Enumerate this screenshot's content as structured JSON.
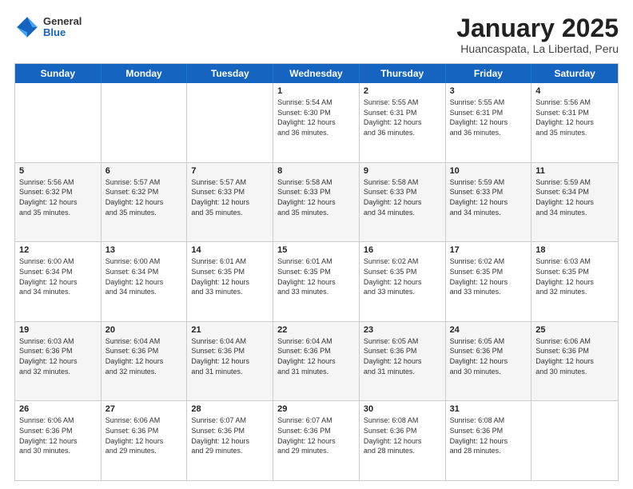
{
  "header": {
    "logo": {
      "general": "General",
      "blue": "Blue"
    },
    "title": "January 2025",
    "subtitle": "Huancaspata, La Libertad, Peru"
  },
  "days": [
    "Sunday",
    "Monday",
    "Tuesday",
    "Wednesday",
    "Thursday",
    "Friday",
    "Saturday"
  ],
  "weeks": [
    [
      {
        "date": "",
        "info": "",
        "empty": true
      },
      {
        "date": "",
        "info": "",
        "empty": true
      },
      {
        "date": "",
        "info": "",
        "empty": true
      },
      {
        "date": "1",
        "info": "Sunrise: 5:54 AM\nSunset: 6:30 PM\nDaylight: 12 hours\nand 36 minutes.",
        "empty": false
      },
      {
        "date": "2",
        "info": "Sunrise: 5:55 AM\nSunset: 6:31 PM\nDaylight: 12 hours\nand 36 minutes.",
        "empty": false
      },
      {
        "date": "3",
        "info": "Sunrise: 5:55 AM\nSunset: 6:31 PM\nDaylight: 12 hours\nand 36 minutes.",
        "empty": false
      },
      {
        "date": "4",
        "info": "Sunrise: 5:56 AM\nSunset: 6:31 PM\nDaylight: 12 hours\nand 35 minutes.",
        "empty": false
      }
    ],
    [
      {
        "date": "5",
        "info": "Sunrise: 5:56 AM\nSunset: 6:32 PM\nDaylight: 12 hours\nand 35 minutes.",
        "empty": false
      },
      {
        "date": "6",
        "info": "Sunrise: 5:57 AM\nSunset: 6:32 PM\nDaylight: 12 hours\nand 35 minutes.",
        "empty": false
      },
      {
        "date": "7",
        "info": "Sunrise: 5:57 AM\nSunset: 6:33 PM\nDaylight: 12 hours\nand 35 minutes.",
        "empty": false
      },
      {
        "date": "8",
        "info": "Sunrise: 5:58 AM\nSunset: 6:33 PM\nDaylight: 12 hours\nand 35 minutes.",
        "empty": false
      },
      {
        "date": "9",
        "info": "Sunrise: 5:58 AM\nSunset: 6:33 PM\nDaylight: 12 hours\nand 34 minutes.",
        "empty": false
      },
      {
        "date": "10",
        "info": "Sunrise: 5:59 AM\nSunset: 6:33 PM\nDaylight: 12 hours\nand 34 minutes.",
        "empty": false
      },
      {
        "date": "11",
        "info": "Sunrise: 5:59 AM\nSunset: 6:34 PM\nDaylight: 12 hours\nand 34 minutes.",
        "empty": false
      }
    ],
    [
      {
        "date": "12",
        "info": "Sunrise: 6:00 AM\nSunset: 6:34 PM\nDaylight: 12 hours\nand 34 minutes.",
        "empty": false
      },
      {
        "date": "13",
        "info": "Sunrise: 6:00 AM\nSunset: 6:34 PM\nDaylight: 12 hours\nand 34 minutes.",
        "empty": false
      },
      {
        "date": "14",
        "info": "Sunrise: 6:01 AM\nSunset: 6:35 PM\nDaylight: 12 hours\nand 33 minutes.",
        "empty": false
      },
      {
        "date": "15",
        "info": "Sunrise: 6:01 AM\nSunset: 6:35 PM\nDaylight: 12 hours\nand 33 minutes.",
        "empty": false
      },
      {
        "date": "16",
        "info": "Sunrise: 6:02 AM\nSunset: 6:35 PM\nDaylight: 12 hours\nand 33 minutes.",
        "empty": false
      },
      {
        "date": "17",
        "info": "Sunrise: 6:02 AM\nSunset: 6:35 PM\nDaylight: 12 hours\nand 33 minutes.",
        "empty": false
      },
      {
        "date": "18",
        "info": "Sunrise: 6:03 AM\nSunset: 6:35 PM\nDaylight: 12 hours\nand 32 minutes.",
        "empty": false
      }
    ],
    [
      {
        "date": "19",
        "info": "Sunrise: 6:03 AM\nSunset: 6:36 PM\nDaylight: 12 hours\nand 32 minutes.",
        "empty": false
      },
      {
        "date": "20",
        "info": "Sunrise: 6:04 AM\nSunset: 6:36 PM\nDaylight: 12 hours\nand 32 minutes.",
        "empty": false
      },
      {
        "date": "21",
        "info": "Sunrise: 6:04 AM\nSunset: 6:36 PM\nDaylight: 12 hours\nand 31 minutes.",
        "empty": false
      },
      {
        "date": "22",
        "info": "Sunrise: 6:04 AM\nSunset: 6:36 PM\nDaylight: 12 hours\nand 31 minutes.",
        "empty": false
      },
      {
        "date": "23",
        "info": "Sunrise: 6:05 AM\nSunset: 6:36 PM\nDaylight: 12 hours\nand 31 minutes.",
        "empty": false
      },
      {
        "date": "24",
        "info": "Sunrise: 6:05 AM\nSunset: 6:36 PM\nDaylight: 12 hours\nand 30 minutes.",
        "empty": false
      },
      {
        "date": "25",
        "info": "Sunrise: 6:06 AM\nSunset: 6:36 PM\nDaylight: 12 hours\nand 30 minutes.",
        "empty": false
      }
    ],
    [
      {
        "date": "26",
        "info": "Sunrise: 6:06 AM\nSunset: 6:36 PM\nDaylight: 12 hours\nand 30 minutes.",
        "empty": false
      },
      {
        "date": "27",
        "info": "Sunrise: 6:06 AM\nSunset: 6:36 PM\nDaylight: 12 hours\nand 29 minutes.",
        "empty": false
      },
      {
        "date": "28",
        "info": "Sunrise: 6:07 AM\nSunset: 6:36 PM\nDaylight: 12 hours\nand 29 minutes.",
        "empty": false
      },
      {
        "date": "29",
        "info": "Sunrise: 6:07 AM\nSunset: 6:36 PM\nDaylight: 12 hours\nand 29 minutes.",
        "empty": false
      },
      {
        "date": "30",
        "info": "Sunrise: 6:08 AM\nSunset: 6:36 PM\nDaylight: 12 hours\nand 28 minutes.",
        "empty": false
      },
      {
        "date": "31",
        "info": "Sunrise: 6:08 AM\nSunset: 6:36 PM\nDaylight: 12 hours\nand 28 minutes.",
        "empty": false
      },
      {
        "date": "",
        "info": "",
        "empty": true
      }
    ]
  ]
}
